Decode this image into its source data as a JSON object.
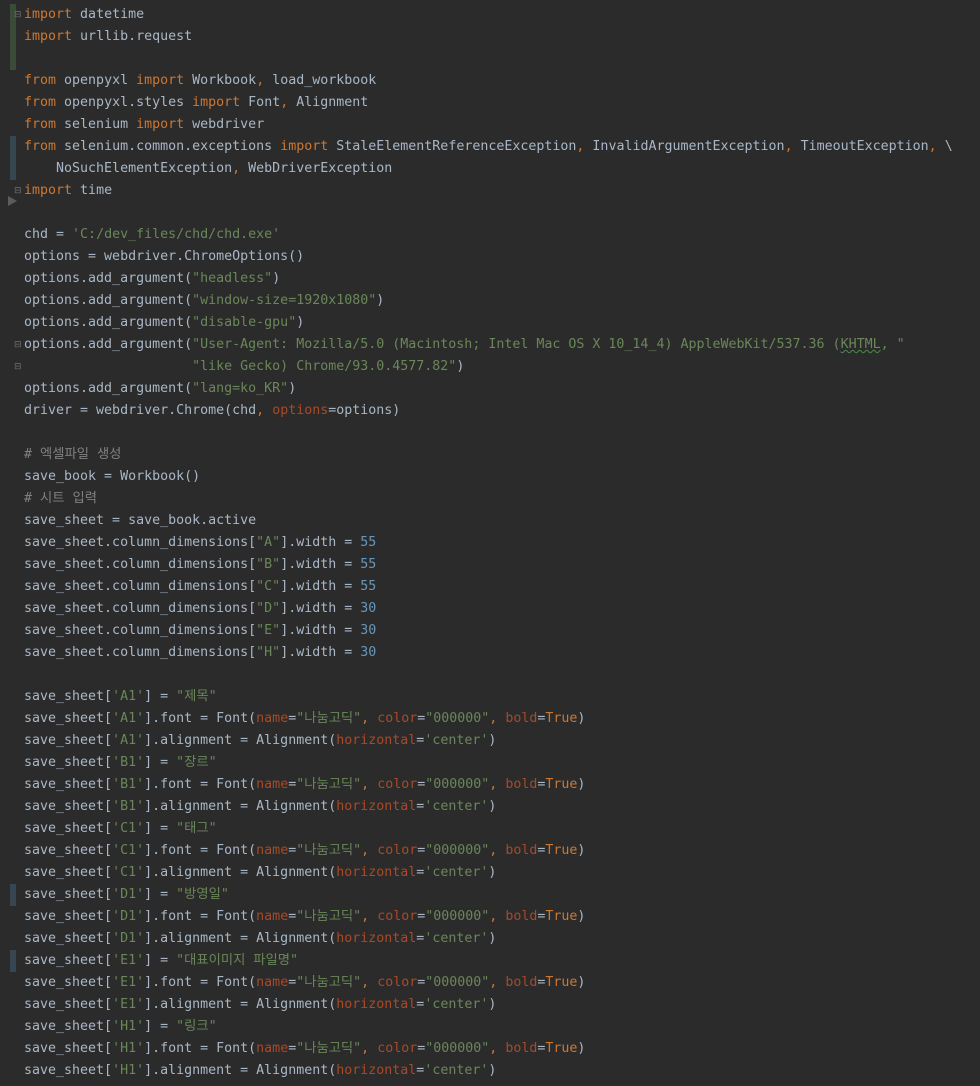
{
  "language": "python",
  "colors": {
    "background": "#2b2b2b",
    "default": "#a9b7c6",
    "keyword": "#cc7832",
    "string": "#6a8759",
    "number": "#6897bb",
    "comment": "#808080",
    "named_argument": "#aa4926",
    "gutter_added": "#384c38",
    "gutter_changed": "#374752"
  },
  "gutter": {
    "fold_icons": [
      "fold-start",
      "fold-end",
      "fold-start",
      "fold-end"
    ],
    "bookmark_icon": "bookmark-arrow-icon"
  },
  "lines": [
    [
      {
        "t": "import",
        "c": "kw"
      },
      {
        "t": " datetime"
      }
    ],
    [
      {
        "t": "import",
        "c": "kw"
      },
      {
        "t": " urllib.request"
      }
    ],
    [],
    [
      {
        "t": "from",
        "c": "kw"
      },
      {
        "t": " openpyxl "
      },
      {
        "t": "import",
        "c": "kw"
      },
      {
        "t": " Workbook"
      },
      {
        "t": ",",
        "c": "kw"
      },
      {
        "t": " load_workbook"
      }
    ],
    [
      {
        "t": "from",
        "c": "kw"
      },
      {
        "t": " openpyxl.styles "
      },
      {
        "t": "import",
        "c": "kw"
      },
      {
        "t": " Font"
      },
      {
        "t": ",",
        "c": "kw"
      },
      {
        "t": " Alignment"
      }
    ],
    [
      {
        "t": "from",
        "c": "kw"
      },
      {
        "t": " selenium "
      },
      {
        "t": "import",
        "c": "kw"
      },
      {
        "t": " webdriver"
      }
    ],
    [
      {
        "t": "from",
        "c": "kw"
      },
      {
        "t": " selenium.common.exceptions "
      },
      {
        "t": "import",
        "c": "kw"
      },
      {
        "t": " StaleElementReferenceException"
      },
      {
        "t": ",",
        "c": "kw"
      },
      {
        "t": " InvalidArgumentException"
      },
      {
        "t": ",",
        "c": "kw"
      },
      {
        "t": " TimeoutException"
      },
      {
        "t": ",",
        "c": "kw"
      },
      {
        "t": " \\"
      }
    ],
    [
      {
        "t": "    NoSuchElementException"
      },
      {
        "t": ",",
        "c": "kw"
      },
      {
        "t": " WebDriverException"
      }
    ],
    [
      {
        "t": "import",
        "c": "kw"
      },
      {
        "t": " time"
      }
    ],
    [],
    [
      {
        "t": "chd = "
      },
      {
        "t": "'C:/dev_files/chd/chd.exe'",
        "c": "str"
      }
    ],
    [
      {
        "t": "options = webdriver.ChromeOptions()"
      }
    ],
    [
      {
        "t": "options.add_argument("
      },
      {
        "t": "\"headless\"",
        "c": "str"
      },
      {
        "t": ")"
      }
    ],
    [
      {
        "t": "options.add_argument("
      },
      {
        "t": "\"window-size=1920x1080\"",
        "c": "str"
      },
      {
        "t": ")"
      }
    ],
    [
      {
        "t": "options.add_argument("
      },
      {
        "t": "\"disable-gpu\"",
        "c": "str"
      },
      {
        "t": ")"
      }
    ],
    [
      {
        "t": "options.add_argument("
      },
      {
        "t": "\"User-Agent: Mozilla/5.0 (Macintosh; Intel Mac OS X 10_14_4) AppleWebKit/537.36 (",
        "c": "str"
      },
      {
        "t": "KHTML",
        "c": "str wavy"
      },
      {
        "t": ", \"",
        "c": "str"
      }
    ],
    [
      {
        "t": "                     "
      },
      {
        "t": "\"like Gecko) Chrome/93.0.4577.82\"",
        "c": "str"
      },
      {
        "t": ")"
      }
    ],
    [
      {
        "t": "options.add_argument("
      },
      {
        "t": "\"lang=ko_KR\"",
        "c": "str"
      },
      {
        "t": ")"
      }
    ],
    [
      {
        "t": "driver = webdriver.Chrome(chd"
      },
      {
        "t": ",",
        "c": "kw"
      },
      {
        "t": " "
      },
      {
        "t": "options",
        "c": "param"
      },
      {
        "t": "=options)"
      }
    ],
    [],
    [
      {
        "t": "# 엑셀파일 생성",
        "c": "cmt"
      }
    ],
    [
      {
        "t": "save_book = Workbook()"
      }
    ],
    [
      {
        "t": "# 시트 입력",
        "c": "cmt"
      }
    ],
    [
      {
        "t": "save_sheet = save_book.active"
      }
    ],
    [
      {
        "t": "save_sheet.column_dimensions["
      },
      {
        "t": "\"A\"",
        "c": "str"
      },
      {
        "t": "].width = "
      },
      {
        "t": "55",
        "c": "num"
      }
    ],
    [
      {
        "t": "save_sheet.column_dimensions["
      },
      {
        "t": "\"B\"",
        "c": "str"
      },
      {
        "t": "].width = "
      },
      {
        "t": "55",
        "c": "num"
      }
    ],
    [
      {
        "t": "save_sheet.column_dimensions["
      },
      {
        "t": "\"C\"",
        "c": "str"
      },
      {
        "t": "].width = "
      },
      {
        "t": "55",
        "c": "num"
      }
    ],
    [
      {
        "t": "save_sheet.column_dimensions["
      },
      {
        "t": "\"D\"",
        "c": "str"
      },
      {
        "t": "].width = "
      },
      {
        "t": "30",
        "c": "num"
      }
    ],
    [
      {
        "t": "save_sheet.column_dimensions["
      },
      {
        "t": "\"E\"",
        "c": "str"
      },
      {
        "t": "].width = "
      },
      {
        "t": "30",
        "c": "num"
      }
    ],
    [
      {
        "t": "save_sheet.column_dimensions["
      },
      {
        "t": "\"H\"",
        "c": "str"
      },
      {
        "t": "].width = "
      },
      {
        "t": "30",
        "c": "num"
      }
    ],
    [],
    [
      {
        "t": "save_sheet["
      },
      {
        "t": "'A1'",
        "c": "str"
      },
      {
        "t": "] = "
      },
      {
        "t": "\"제목\"",
        "c": "str"
      }
    ],
    [
      {
        "t": "save_sheet["
      },
      {
        "t": "'A1'",
        "c": "str"
      },
      {
        "t": "].font = Font("
      },
      {
        "t": "name",
        "c": "param"
      },
      {
        "t": "="
      },
      {
        "t": "\"나눔고딕\"",
        "c": "str"
      },
      {
        "t": ",",
        "c": "kw"
      },
      {
        "t": " "
      },
      {
        "t": "color",
        "c": "param"
      },
      {
        "t": "="
      },
      {
        "t": "\"000000\"",
        "c": "str"
      },
      {
        "t": ",",
        "c": "kw"
      },
      {
        "t": " "
      },
      {
        "t": "bold",
        "c": "param"
      },
      {
        "t": "="
      },
      {
        "t": "True",
        "c": "kw"
      },
      {
        "t": ")"
      }
    ],
    [
      {
        "t": "save_sheet["
      },
      {
        "t": "'A1'",
        "c": "str"
      },
      {
        "t": "].alignment = Alignment("
      },
      {
        "t": "horizontal",
        "c": "param"
      },
      {
        "t": "="
      },
      {
        "t": "'center'",
        "c": "str"
      },
      {
        "t": ")"
      }
    ],
    [
      {
        "t": "save_sheet["
      },
      {
        "t": "'B1'",
        "c": "str"
      },
      {
        "t": "] = "
      },
      {
        "t": "\"장르\"",
        "c": "str"
      }
    ],
    [
      {
        "t": "save_sheet["
      },
      {
        "t": "'B1'",
        "c": "str"
      },
      {
        "t": "].font = Font("
      },
      {
        "t": "name",
        "c": "param"
      },
      {
        "t": "="
      },
      {
        "t": "\"나눔고딕\"",
        "c": "str"
      },
      {
        "t": ",",
        "c": "kw"
      },
      {
        "t": " "
      },
      {
        "t": "color",
        "c": "param"
      },
      {
        "t": "="
      },
      {
        "t": "\"000000\"",
        "c": "str"
      },
      {
        "t": ",",
        "c": "kw"
      },
      {
        "t": " "
      },
      {
        "t": "bold",
        "c": "param"
      },
      {
        "t": "="
      },
      {
        "t": "True",
        "c": "kw"
      },
      {
        "t": ")"
      }
    ],
    [
      {
        "t": "save_sheet["
      },
      {
        "t": "'B1'",
        "c": "str"
      },
      {
        "t": "].alignment = Alignment("
      },
      {
        "t": "horizontal",
        "c": "param"
      },
      {
        "t": "="
      },
      {
        "t": "'center'",
        "c": "str"
      },
      {
        "t": ")"
      }
    ],
    [
      {
        "t": "save_sheet["
      },
      {
        "t": "'C1'",
        "c": "str"
      },
      {
        "t": "] = "
      },
      {
        "t": "\"태그\"",
        "c": "str"
      }
    ],
    [
      {
        "t": "save_sheet["
      },
      {
        "t": "'C1'",
        "c": "str"
      },
      {
        "t": "].font = Font("
      },
      {
        "t": "name",
        "c": "param"
      },
      {
        "t": "="
      },
      {
        "t": "\"나눔고딕\"",
        "c": "str"
      },
      {
        "t": ",",
        "c": "kw"
      },
      {
        "t": " "
      },
      {
        "t": "color",
        "c": "param"
      },
      {
        "t": "="
      },
      {
        "t": "\"000000\"",
        "c": "str"
      },
      {
        "t": ",",
        "c": "kw"
      },
      {
        "t": " "
      },
      {
        "t": "bold",
        "c": "param"
      },
      {
        "t": "="
      },
      {
        "t": "True",
        "c": "kw"
      },
      {
        "t": ")"
      }
    ],
    [
      {
        "t": "save_sheet["
      },
      {
        "t": "'C1'",
        "c": "str"
      },
      {
        "t": "].alignment = Alignment("
      },
      {
        "t": "horizontal",
        "c": "param"
      },
      {
        "t": "="
      },
      {
        "t": "'center'",
        "c": "str"
      },
      {
        "t": ")"
      }
    ],
    [
      {
        "t": "save_sheet["
      },
      {
        "t": "'D1'",
        "c": "str"
      },
      {
        "t": "] = "
      },
      {
        "t": "\"방영일\"",
        "c": "str"
      }
    ],
    [
      {
        "t": "save_sheet["
      },
      {
        "t": "'D1'",
        "c": "str"
      },
      {
        "t": "].font = Font("
      },
      {
        "t": "name",
        "c": "param"
      },
      {
        "t": "="
      },
      {
        "t": "\"나눔고딕\"",
        "c": "str"
      },
      {
        "t": ",",
        "c": "kw"
      },
      {
        "t": " "
      },
      {
        "t": "color",
        "c": "param"
      },
      {
        "t": "="
      },
      {
        "t": "\"000000\"",
        "c": "str"
      },
      {
        "t": ",",
        "c": "kw"
      },
      {
        "t": " "
      },
      {
        "t": "bold",
        "c": "param"
      },
      {
        "t": "="
      },
      {
        "t": "True",
        "c": "kw"
      },
      {
        "t": ")"
      }
    ],
    [
      {
        "t": "save_sheet["
      },
      {
        "t": "'D1'",
        "c": "str"
      },
      {
        "t": "].alignment = Alignment("
      },
      {
        "t": "horizontal",
        "c": "param"
      },
      {
        "t": "="
      },
      {
        "t": "'center'",
        "c": "str"
      },
      {
        "t": ")"
      }
    ],
    [
      {
        "t": "save_sheet["
      },
      {
        "t": "'E1'",
        "c": "str"
      },
      {
        "t": "] = "
      },
      {
        "t": "\"대표이미지 파일명\"",
        "c": "str"
      }
    ],
    [
      {
        "t": "save_sheet["
      },
      {
        "t": "'E1'",
        "c": "str"
      },
      {
        "t": "].font = Font("
      },
      {
        "t": "name",
        "c": "param"
      },
      {
        "t": "="
      },
      {
        "t": "\"나눔고딕\"",
        "c": "str"
      },
      {
        "t": ",",
        "c": "kw"
      },
      {
        "t": " "
      },
      {
        "t": "color",
        "c": "param"
      },
      {
        "t": "="
      },
      {
        "t": "\"000000\"",
        "c": "str"
      },
      {
        "t": ",",
        "c": "kw"
      },
      {
        "t": " "
      },
      {
        "t": "bold",
        "c": "param"
      },
      {
        "t": "="
      },
      {
        "t": "True",
        "c": "kw"
      },
      {
        "t": ")"
      }
    ],
    [
      {
        "t": "save_sheet["
      },
      {
        "t": "'E1'",
        "c": "str"
      },
      {
        "t": "].alignment = Alignment("
      },
      {
        "t": "horizontal",
        "c": "param"
      },
      {
        "t": "="
      },
      {
        "t": "'center'",
        "c": "str"
      },
      {
        "t": ")"
      }
    ],
    [
      {
        "t": "save_sheet["
      },
      {
        "t": "'H1'",
        "c": "str"
      },
      {
        "t": "] = "
      },
      {
        "t": "\"링크\"",
        "c": "str"
      }
    ],
    [
      {
        "t": "save_sheet["
      },
      {
        "t": "'H1'",
        "c": "str"
      },
      {
        "t": "].font = Font("
      },
      {
        "t": "name",
        "c": "param"
      },
      {
        "t": "="
      },
      {
        "t": "\"나눔고딕\"",
        "c": "str"
      },
      {
        "t": ",",
        "c": "kw"
      },
      {
        "t": " "
      },
      {
        "t": "color",
        "c": "param"
      },
      {
        "t": "="
      },
      {
        "t": "\"000000\"",
        "c": "str"
      },
      {
        "t": ",",
        "c": "kw"
      },
      {
        "t": " "
      },
      {
        "t": "bold",
        "c": "param"
      },
      {
        "t": "="
      },
      {
        "t": "True",
        "c": "kw"
      },
      {
        "t": ")"
      }
    ],
    [
      {
        "t": "save_sheet["
      },
      {
        "t": "'H1'",
        "c": "str"
      },
      {
        "t": "].alignment = Alignment("
      },
      {
        "t": "horizontal",
        "c": "param"
      },
      {
        "t": "="
      },
      {
        "t": "'center'",
        "c": "str"
      },
      {
        "t": ")"
      }
    ]
  ]
}
